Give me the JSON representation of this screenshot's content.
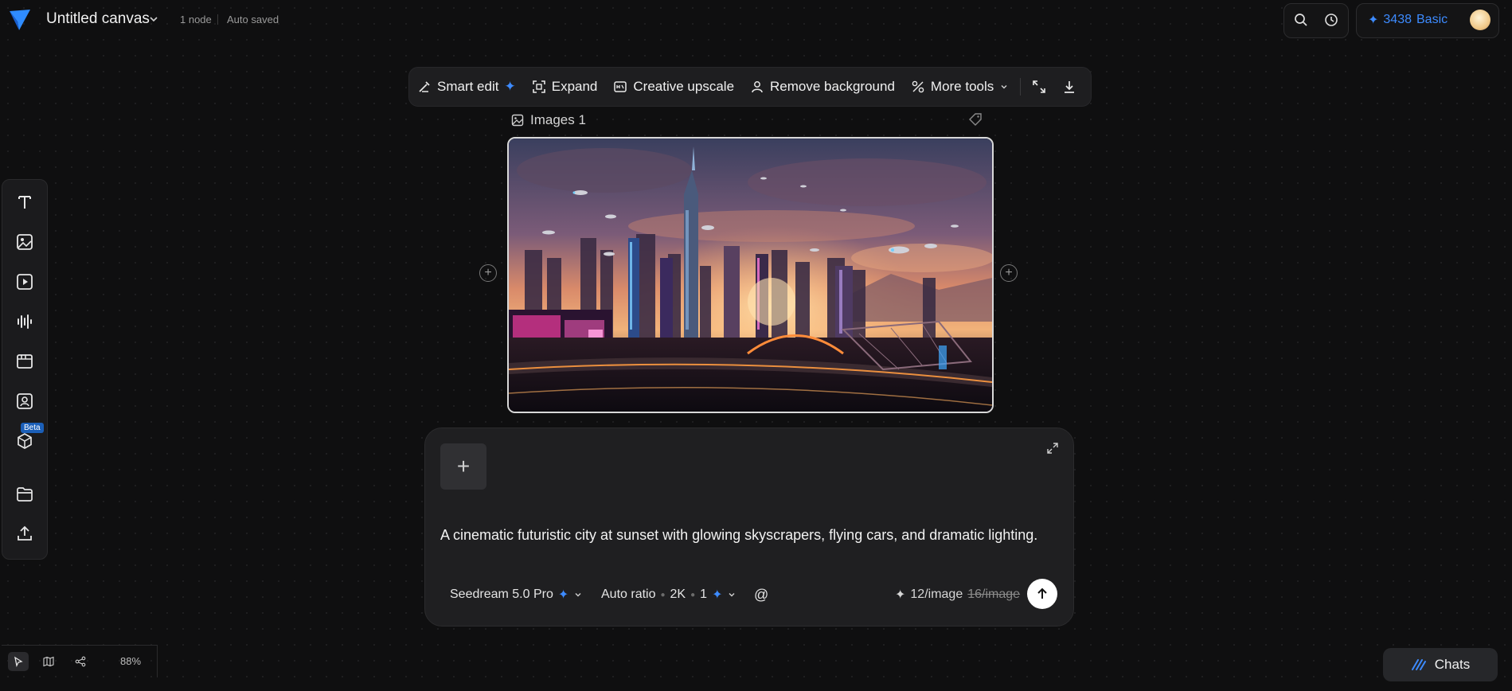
{
  "header": {
    "title": "Untitled canvas",
    "node_count": "1 node",
    "save_status": "Auto saved",
    "credits": "3438",
    "plan": "Basic"
  },
  "toolbar": {
    "smart_edit": "Smart edit",
    "expand": "Expand",
    "creative_upscale": "Creative upscale",
    "remove_background": "Remove background",
    "more_tools": "More tools"
  },
  "node": {
    "label": "Images 1"
  },
  "sidebar": {
    "beta_badge": "Beta",
    "icons": [
      "text-icon",
      "image-icon",
      "video-icon",
      "audio-icon",
      "storyboard-icon",
      "avatar-icon",
      "3d-icon",
      "folder-icon",
      "upload-icon"
    ]
  },
  "prompt_panel": {
    "prompt_text": "A cinematic futuristic city at sunset with glowing skyscrapers, flying cars, and dramatic lighting.",
    "model": "Seedream 5.0 Pro",
    "ratio": "Auto ratio",
    "resolution": "2K",
    "count": "1",
    "mention": "@",
    "price": "12/image",
    "old_price": "16/image"
  },
  "footer": {
    "zoom": "88%",
    "chats_label": "Chats"
  },
  "colors": {
    "accent": "#3d8bff",
    "background": "#0f0f10",
    "panel": "#1f1f21"
  }
}
